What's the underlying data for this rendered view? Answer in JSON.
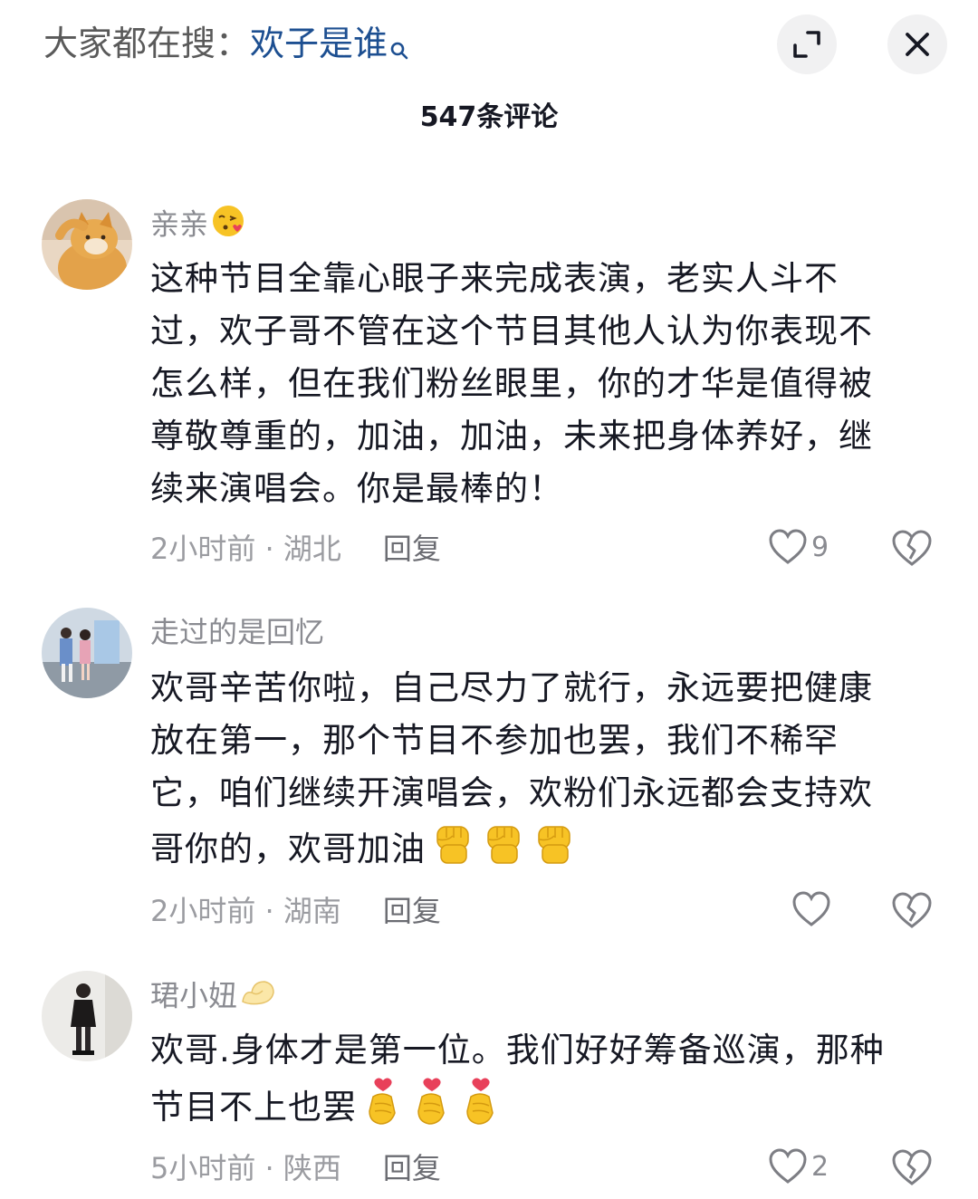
{
  "header": {
    "search_prefix": "大家都在搜：",
    "search_term": "欢子是谁",
    "comment_count": "547条评论"
  },
  "comments": [
    {
      "username": "亲亲",
      "body_lines": [
        "这种节目全靠心眼子来完成表演，老实人斗不",
        "过，欢子哥不管在这个节目其他人认为你表现不",
        "怎么样，但在我们粉丝眼里，你的才华是值得被",
        "尊敬尊重的，加油，加油，未来把身体养好，继",
        "续来演唱会。你是最棒的！"
      ],
      "time": "2小时前",
      "location": "湖北",
      "reply_label": "回复",
      "likes": "9"
    },
    {
      "username": "走过的是回忆",
      "body_lines": [
        "欢哥辛苦你啦，自己尽力了就行，永远要把健康",
        "放在第一，那个节目不参加也罢，我们不稀罕",
        "它，咱们继续开演唱会，欢粉们永远都会支持欢",
        "哥你的，欢哥加油"
      ],
      "time": "2小时前",
      "location": "湖南",
      "reply_label": "回复",
      "likes": ""
    },
    {
      "username": "珺小妞",
      "body_lines": [
        "欢哥.身体才是第一位。我们好好筹备巡演，那种",
        "节目不上也罢"
      ],
      "time": "5小时前",
      "location": "陕西",
      "reply_label": "回复",
      "likes": "2"
    }
  ],
  "icons": {
    "expand": "expand-icon",
    "close": "close-icon",
    "like": "heart-outline-icon",
    "dislike": "broken-heart-icon",
    "fist": "raised-fist-emoji",
    "finger_heart": "finger-heart-emoji",
    "kiss": "kiss-emoji",
    "muscle": "flexed-biceps-emoji"
  },
  "colors": {
    "search_term": "#1d4f91",
    "meta": "#9b9ca1",
    "emoji_yellow": "#f7c325"
  }
}
